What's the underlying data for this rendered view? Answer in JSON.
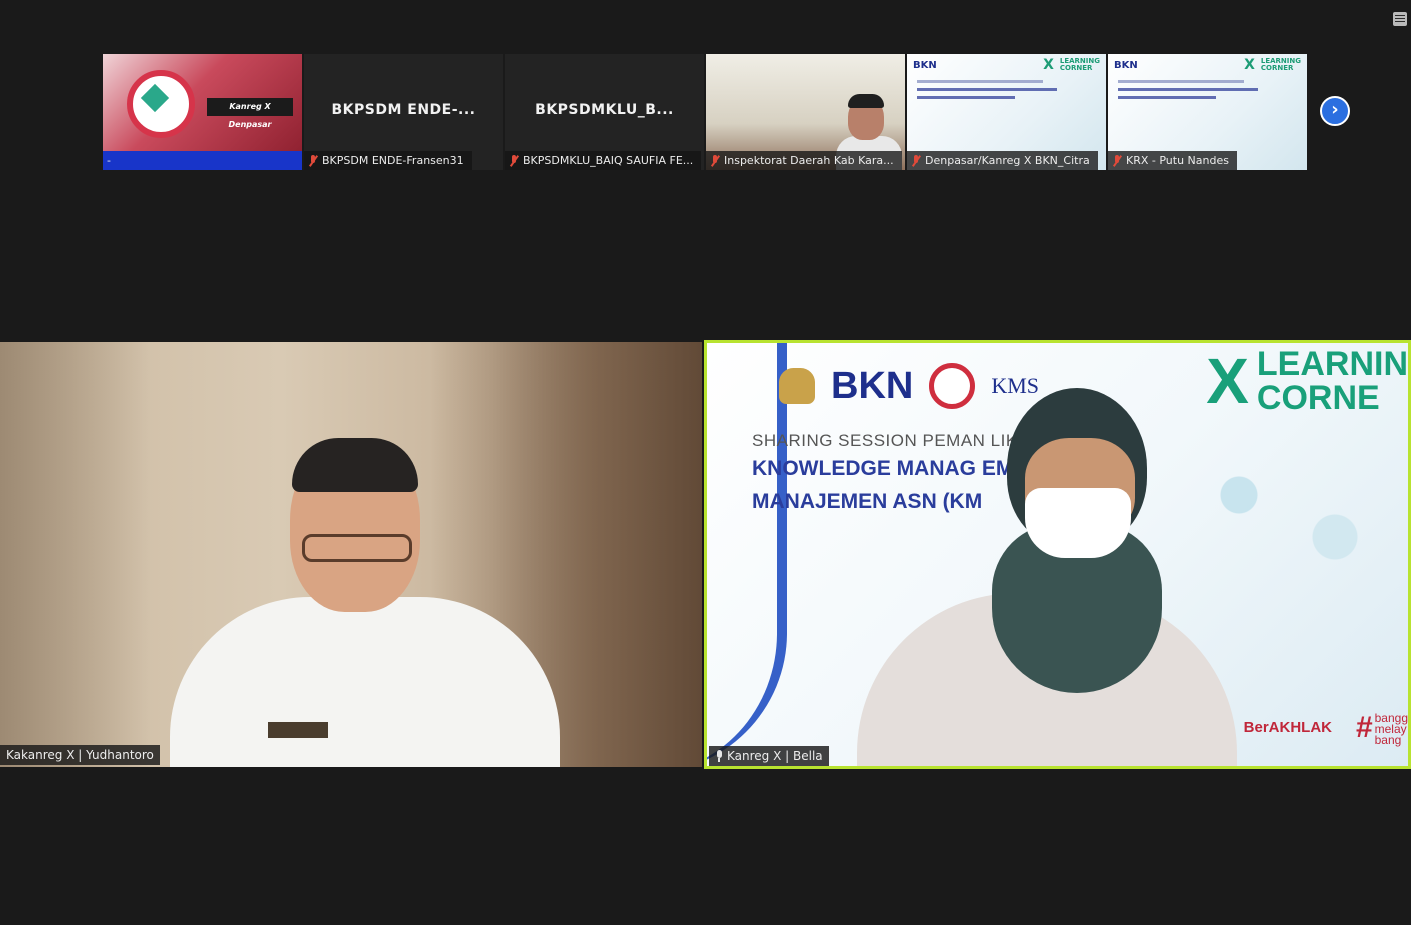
{
  "thumbnails": [
    {
      "display_title": "",
      "name": "-",
      "muted": false,
      "kind": "logo",
      "logo_caption": "Kanreg X Denpasar"
    },
    {
      "display_title": "BKPSDM  ENDE-...",
      "name": "BKPSDM ENDE-Fransen31",
      "muted": true,
      "kind": "name-only"
    },
    {
      "display_title": "BKPSDMKLU_B...",
      "name": "BKPSDMKLU_BAIQ SAUFIA FE...",
      "muted": true,
      "kind": "name-only"
    },
    {
      "display_title": "",
      "name": "Inspektorat Daerah Kab Kara...",
      "muted": true,
      "kind": "video"
    },
    {
      "display_title": "",
      "name": "Denpasar/Kanreg X BKN_Citra",
      "muted": true,
      "kind": "slide"
    },
    {
      "display_title": "",
      "name": "KRX - Putu Nandes",
      "muted": true,
      "kind": "slide"
    }
  ],
  "slide_mini": {
    "bkn": "BKN",
    "x": "X",
    "learning": "LEARNING",
    "corner": "CORNER"
  },
  "main_left": {
    "name": "Kakanreg X | Yudhantoro"
  },
  "main_right": {
    "name": "Kanreg X | Bella",
    "slide": {
      "bkn": "BKN",
      "kms": "KMS",
      "lc_x": "X",
      "lc_line1": "LEARNIN",
      "lc_line2": "CORNE",
      "subtitle": "SHARING SESSION PEMAN         LIKASI",
      "title_line1": "KNOWLEDGE MANAG                EM",
      "title_line2": "MANAJEMEN ASN (KM",
      "berakhlak": "BerAKHLAK",
      "bangga_1": "bangg",
      "bangga_2": "melay",
      "bangga_3": "bang"
    }
  },
  "colors": {
    "active_speaker_border": "#b8e330",
    "nav_arrow": "#2b6fe0",
    "muted_mic": "#e04a3a"
  }
}
